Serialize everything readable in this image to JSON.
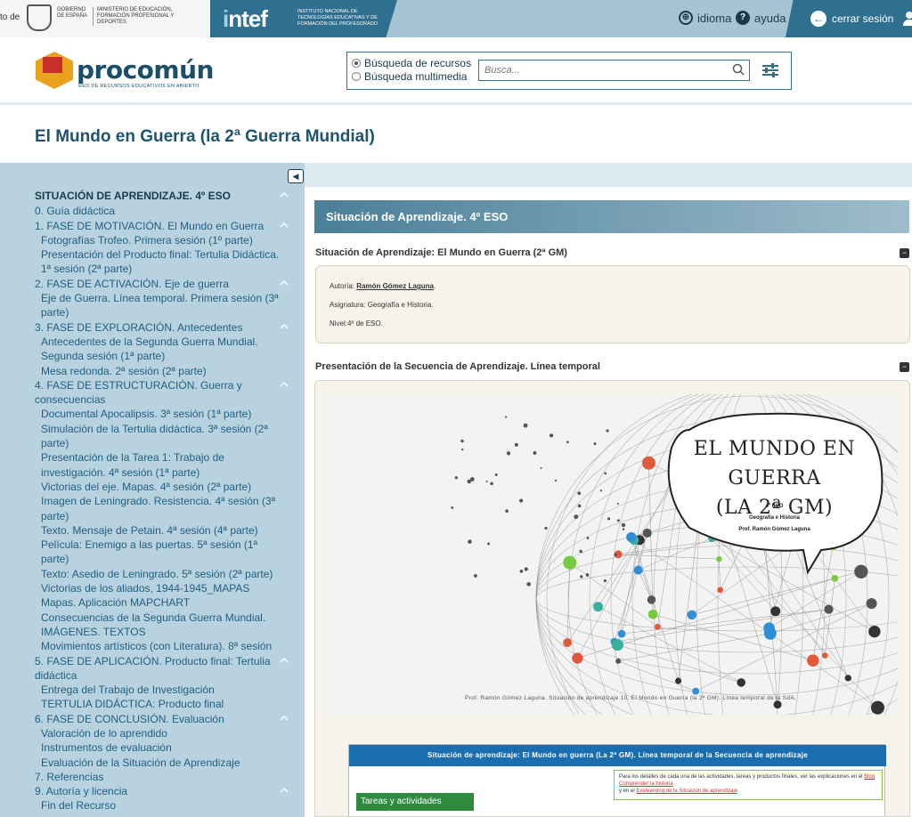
{
  "topbar": {
    "gov_cut_text": "to de",
    "gov_line1": "GOBIERNO DE ESPAÑA",
    "gov_line2": "MINISTERIO DE EDUCACIÓN, FORMACIÓN PROFESIONAL Y DEPORTES",
    "intef_logo_a": "i",
    "intef_logo_b": "ntef",
    "intef_sub": "INSTITUTO NACIONAL DE TECNOLOGÍAS EDUCATIVAS Y DE FORMACIÓN DEL PROFESORADO",
    "idioma": "idioma",
    "ayuda": "ayuda",
    "cerrar": "cerrar sesión"
  },
  "header": {
    "brand": "procomún",
    "tagline": "RED DE RECURSOS EDUCATIVOS EN ABIERTO",
    "radio1": "Búsqueda de recursos",
    "radio2": "Búsqueda multimedia",
    "search_placeholder": "Busca..."
  },
  "page_title": "El Mundo en Guerra (la 2ª Guerra Mundial)",
  "sidebar": {
    "top": "SITUACIÓN DE APRENDIZAJE. 4º ESO",
    "items": [
      {
        "type": "sec",
        "label": "0. Guía didáctica"
      },
      {
        "type": "sec",
        "label": "1. FASE DE MOTIVACIÓN. El Mundo en Guerra",
        "chev": true
      },
      {
        "type": "sub",
        "label": "Fotografías Trofeo. Primera sesión (1º parte)"
      },
      {
        "type": "sub",
        "label": "Presentación del Producto final: Tertulia Didáctica. 1ª sesión (2ª parte)"
      },
      {
        "type": "sec",
        "label": "2. FASE DE ACTIVACIÓN. Eje de guerra",
        "chev": true
      },
      {
        "type": "sub",
        "label": "Eje de Guerra. Línea temporal. Primera sesión (3ª parte)"
      },
      {
        "type": "sec",
        "label": "3. FASE DE EXPLORACIÓN. Antecedentes",
        "chev": true
      },
      {
        "type": "sub",
        "label": "Antecedentes de la Segunda Guerra Mundial. Segunda sesión (1ª parte)"
      },
      {
        "type": "sub",
        "label": "Mesa redonda. 2ª sesión (2ª parte)"
      },
      {
        "type": "sec",
        "label": "4. FASE DE ESTRUCTURACIÓN. Guerra y consecuencias",
        "chev": true
      },
      {
        "type": "sub",
        "label": "Documental Apocalipsis. 3ª sesión (1ª parte)"
      },
      {
        "type": "sub",
        "label": "Simulación de la Tertulia didáctica. 3ª sesión (2ª parte)"
      },
      {
        "type": "sub",
        "label": "Presentación de la Tarea 1: Trabajo de investigación. 4ª sesión (1ª parte)"
      },
      {
        "type": "sub",
        "label": "Victorias del eje. Mapas. 4ª sesión (2ª parte)"
      },
      {
        "type": "sub",
        "label": "Imagen de Leningrado. Resistencia. 4ª sesión (3ª parte)"
      },
      {
        "type": "sub",
        "label": "Texto. Mensaje de Petain. 4ª sesión (4ª parte)"
      },
      {
        "type": "sub",
        "label": "Película: Enemigo a las puertas. 5ª sesión (1ª parte)"
      },
      {
        "type": "sub",
        "label": "Texto: Asedio de Leningrado. 5ª sesión (2ª parte)"
      },
      {
        "type": "sub",
        "label": "Victorias de los aliados, 1944-1945_MAPAS"
      },
      {
        "type": "sub",
        "label": "Mapas. Aplicación MAPCHART"
      },
      {
        "type": "sub",
        "label": "Consecuencias de la Segunda Guerra Mundial. IMÁGENES. TEXTOS"
      },
      {
        "type": "sub",
        "label": "Movimientos artísticos (con Literatura). 8ª sesión"
      },
      {
        "type": "sec",
        "label": "5. FASE DE APLICACIÓN. Producto final: Tertulia didáctica",
        "chev": true
      },
      {
        "type": "sub",
        "label": "Entrega del Trabajo de Investigación"
      },
      {
        "type": "sub",
        "label": "TERTULIA DIDÁCTICA: Producto final"
      },
      {
        "type": "sec",
        "label": "6. FASE DE CONCLUSIÓN. Evaluación",
        "chev": true
      },
      {
        "type": "sub",
        "label": "Valoración de lo aprendido"
      },
      {
        "type": "sub",
        "label": "Instrumentos de evaluación"
      },
      {
        "type": "sub",
        "label": "Evaluación de la Situación de Aprendizaje"
      },
      {
        "type": "sec",
        "label": "7. Referencias"
      },
      {
        "type": "sec",
        "label": "9. Autoría y licencia",
        "chev": true
      },
      {
        "type": "sub",
        "label": "Fin del Recurso"
      }
    ]
  },
  "content": {
    "band_title": "Situación de Aprendizaje. 4º ESO",
    "section1": "Situación de Aprendizaje: El Mundo en Guerra (2ª GM)",
    "autoria_label": "Autoría: ",
    "autoria_name": "Ramón Gómez Laguna",
    "asignatura": "Asignatura: Geografía e Historia.",
    "nivel": "Nivel:4º de ESO.",
    "section2": "Presentación de la Secuencia de Aprendizaje. Línea temporal",
    "slide_title1": "EL MUNDO EN GUERRA",
    "slide_title2": "(LA 2ª GM)",
    "slide_sub1": "4º ESO",
    "slide_sub2": "Geografía e Historia",
    "slide_sub3": "Prof. Ramón Gómez Laguna",
    "slide_caption": "Prof. Ramón Gómez Laguna. Situación de aprendizaje 10. El Mundo en Guerra (la 2ª GM). Línea temporal de la SdA.",
    "embed_header": "Situación de aprendizaje: El Mundo en guerra (La 2ª GM). Línea temporal de la Secuencia de aprendizaje",
    "embed_note_a": "Para los detalles de cada una de las actividades, tareas y productos finales, ver las explicaciones en el ",
    "embed_note_link1": "Blog Comprender la historia",
    "embed_note_b": "y en el ",
    "embed_note_link2": "Exelearning de la Situación de aprendizaje",
    "embed_tareas": "Tareas y actividades"
  }
}
